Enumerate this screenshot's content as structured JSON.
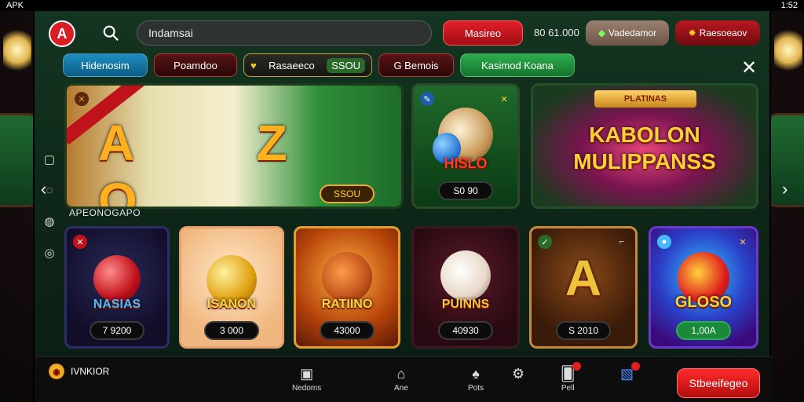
{
  "statusbar": {
    "left": "APK",
    "right": "1:52"
  },
  "header": {
    "logo": "A",
    "search_value": "Indamsai",
    "red_button": "Masireo",
    "balance": "80 61.000",
    "gray_button": "Vadedamor",
    "dkred_button": "Raesoeaov"
  },
  "tabs": [
    {
      "label": "Hidenosim"
    },
    {
      "label": "Poamdoo"
    },
    {
      "label": "Rasaeeco",
      "count": "SSOU"
    },
    {
      "label": "G Bemois"
    },
    {
      "label": "Kasimod Koana"
    }
  ],
  "section_label": "APEONOGAPO",
  "cards_top": [
    {
      "title": "A Z O",
      "price": "SSOU"
    },
    {
      "title": "HISLO",
      "price": "S0 90"
    },
    {
      "banner_top": "PLATINAS",
      "title": "KABOLON MULIPPANSS"
    }
  ],
  "cards_bottom": [
    {
      "title": "NASIAS",
      "price": "7 9200"
    },
    {
      "title": "ISANON",
      "price": "3 000"
    },
    {
      "title": "RATIINO",
      "price": "43000"
    },
    {
      "title": "PUINNS",
      "price": "40930"
    },
    {
      "title": "A",
      "price": "S 2010"
    },
    {
      "title": "GLOSO",
      "price": "1,00A"
    }
  ],
  "bottom": {
    "brand": "IVNKIOR",
    "items": [
      {
        "label": "Nedoms"
      },
      {
        "label": "Ane"
      },
      {
        "label": "Pots"
      },
      {
        "label": ""
      },
      {
        "label": "Pell"
      },
      {
        "label": ""
      }
    ],
    "cta": "Stbeeifegeo"
  },
  "colors": {
    "accent_red": "#d81f26",
    "accent_green": "#2cae4e",
    "accent_blue": "#1d8fc1"
  }
}
